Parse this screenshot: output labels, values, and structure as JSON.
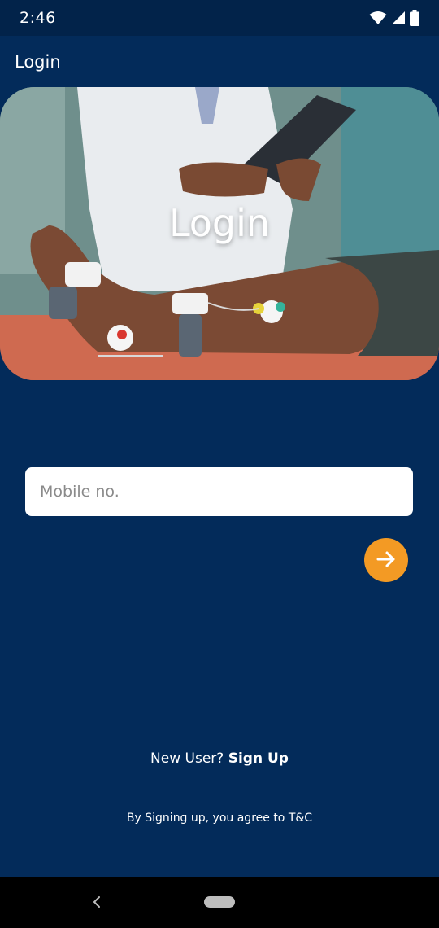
{
  "status_bar": {
    "time": "2:46",
    "icons": [
      "wifi-icon",
      "signal-icon",
      "battery-icon"
    ]
  },
  "app_bar": {
    "title": "Login"
  },
  "hero": {
    "title": "Login",
    "image": "doctor-with-tablet-patient-leg-with-sensors"
  },
  "form": {
    "mobile_placeholder": "Mobile no.",
    "mobile_value": "",
    "submit_icon": "arrow-right-icon"
  },
  "signup": {
    "prompt": "New User? ",
    "link": "Sign Up"
  },
  "terms": {
    "text": "By Signing up, you agree to T&C"
  },
  "nav_bar": {
    "icons": [
      "back-icon",
      "home-pill"
    ]
  },
  "colors": {
    "background": "#032b5a",
    "status_bar": "#02234a",
    "accent": "#f39a24",
    "text": "#ffffff"
  }
}
